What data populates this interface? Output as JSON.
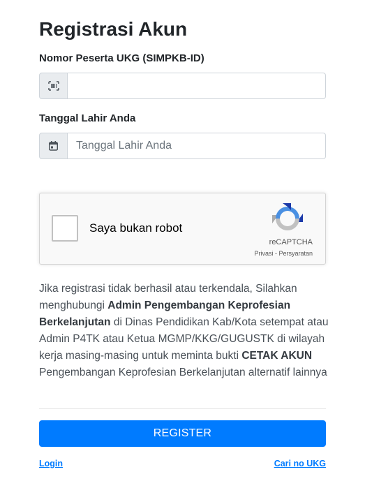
{
  "page": {
    "title": "Registrasi Akun"
  },
  "form": {
    "nomor_peserta": {
      "label": "Nomor Peserta UKG (SIMPKB-ID)",
      "icon": "barcode-icon",
      "value": "",
      "placeholder": ""
    },
    "tanggal_lahir": {
      "label": "Tanggal Lahir Anda",
      "icon": "calendar-icon",
      "value": "",
      "placeholder": "Tanggal Lahir Anda"
    }
  },
  "recaptcha": {
    "checkbox_label": "Saya bukan robot",
    "brand": "reCAPTCHA",
    "privacy_link": "Privasi",
    "separator": " - ",
    "terms_link": "Persyaratan",
    "checked": false
  },
  "info": {
    "part1": "Jika registrasi tidak berhasil atau terkendala, Silahkan menghubungi ",
    "bold1": "Admin Pengembangan Keprofesian Berkelanjutan",
    "part2": " di Dinas Pendidikan Kab/Kota setempat atau Admin P4TK atau Ketua MGMP/KKG/GUGUSTK di wilayah kerja masing-masing untuk meminta bukti ",
    "bold2": "CETAK AKUN",
    "part3": " Pengembangan Keprofesian Berkelanjutan alternatif lainnya"
  },
  "actions": {
    "register_label": "REGISTER",
    "login_label": "Login",
    "cari_label": "Cari no UKG"
  },
  "colors": {
    "primary": "#007bff",
    "addon_bg": "#e9ecef",
    "border": "#ced4da"
  }
}
